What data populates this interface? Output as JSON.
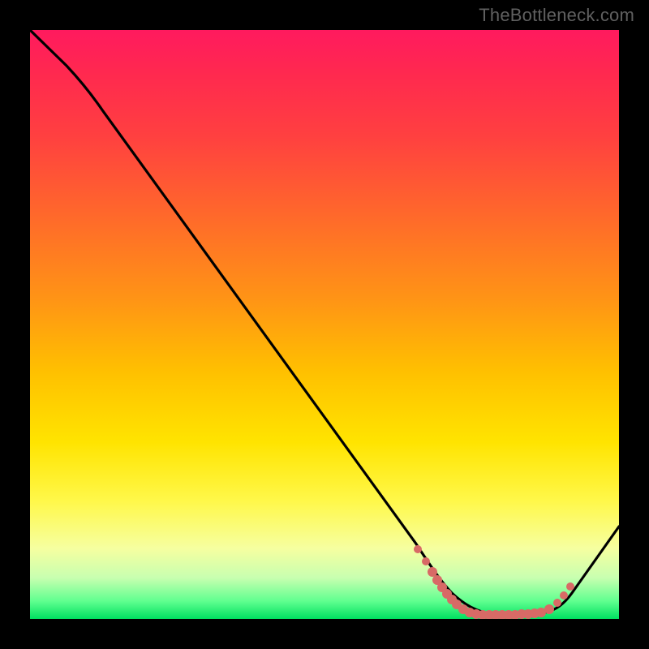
{
  "watermark": "TheBottleneck.com",
  "chart_data": {
    "type": "line",
    "title": "",
    "xlabel": "",
    "ylabel": "",
    "xlim": [
      0,
      100
    ],
    "ylim": [
      0,
      100
    ],
    "series": [
      {
        "name": "bottleneck-curve",
        "x": [
          0,
          6,
          12,
          20,
          30,
          40,
          50,
          60,
          65,
          70,
          74,
          78,
          82,
          86,
          90,
          94,
          100
        ],
        "y": [
          100,
          94,
          88,
          80,
          66,
          52,
          38,
          24,
          16,
          9,
          4,
          1,
          0,
          0,
          2,
          7,
          16
        ]
      }
    ],
    "highlighted_points": {
      "name": "optimal-range",
      "color": "#d86a66",
      "x": [
        66,
        67,
        68,
        69,
        70,
        71,
        72,
        73,
        74,
        75,
        76,
        77,
        78,
        79,
        80,
        81,
        82,
        83,
        84,
        85,
        86,
        87,
        88,
        89,
        90,
        91,
        92
      ],
      "y": [
        12,
        10,
        8,
        7,
        6,
        5,
        4,
        3,
        2,
        1.5,
        1,
        0.7,
        0.5,
        0.3,
        0.2,
        0.2,
        0.2,
        0.2,
        0.3,
        0.5,
        0.7,
        1,
        1.5,
        2,
        3,
        4,
        5
      ]
    },
    "background_gradient": {
      "orientation": "vertical",
      "stops": [
        {
          "pos": 0.0,
          "color": "#ff1a5e"
        },
        {
          "pos": 0.18,
          "color": "#ff4040"
        },
        {
          "pos": 0.46,
          "color": "#ff9515"
        },
        {
          "pos": 0.7,
          "color": "#ffe400"
        },
        {
          "pos": 0.88,
          "color": "#f6ffa0"
        },
        {
          "pos": 1.0,
          "color": "#00e060"
        }
      ]
    }
  }
}
